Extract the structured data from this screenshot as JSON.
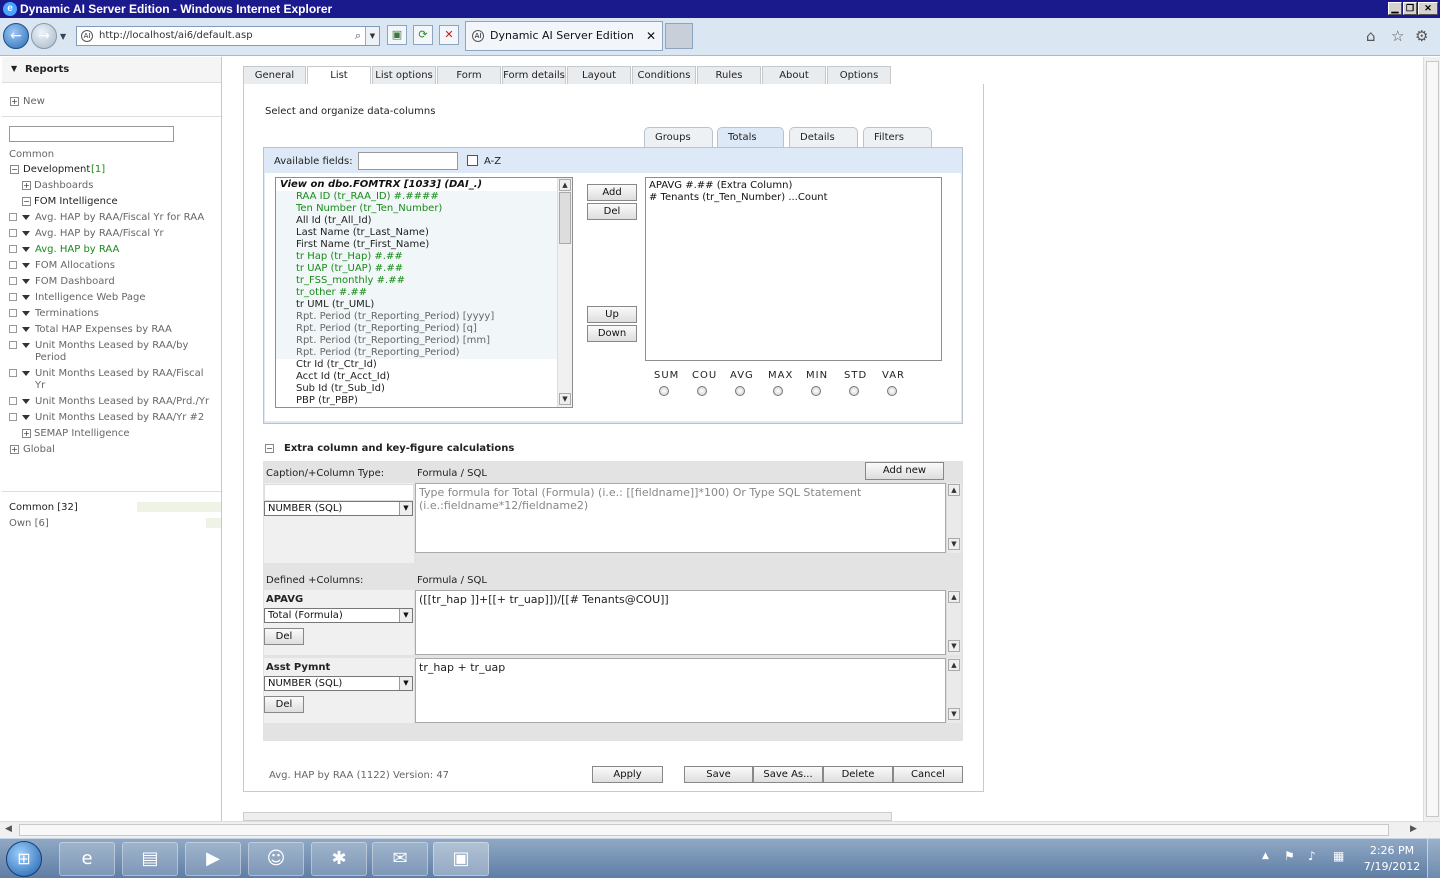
{
  "window": {
    "title": "Dynamic AI Server Edition - Windows Internet Explorer"
  },
  "browser": {
    "url": "http://localhost/ai6/default.asp",
    "tab_title": "Dynamic AI Server Edition",
    "tab_close": "✕"
  },
  "sidebar": {
    "header": "Reports",
    "new": "New",
    "common_label": "Common",
    "development": "Development",
    "development_count": "[1]",
    "dashboards": "Dashboards",
    "fom_intelligence": "FOM Intelligence",
    "reports": [
      "Avg. HAP by RAA/Fiscal Yr for RAA",
      "Avg. HAP by RAA/Fiscal Yr",
      "Avg. HAP by RAA",
      "FOM Allocations",
      "FOM Dashboard",
      "Intelligence Web Page",
      "Terminations",
      "Total HAP Expenses by RAA",
      "Unit Months Leased by RAA/by",
      "Period",
      "Unit Months Leased by RAA/Fiscal",
      "Yr",
      "Unit Months Leased by RAA/Prd./Yr",
      "Unit Months Leased by RAA/Yr #2"
    ],
    "semap": "SEMAP Intelligence",
    "global": "Global",
    "common_count": "Common [32]",
    "own_count": "Own [6]"
  },
  "tabs": [
    "General",
    "List",
    "List options",
    "Form",
    "Form details",
    "Layout",
    "Conditions",
    "Rules",
    "About",
    "Options"
  ],
  "main": {
    "instruction": "Select and organize data-columns",
    "subtabs": [
      "Groups",
      "Totals",
      "Details",
      "Filters"
    ],
    "available_fields_label": "Available fields:",
    "az_label": "A-Z",
    "field_list_header": "View on dbo.FOMTRX [1033] (DAI_.)",
    "fields": [
      "RAA ID (tr_RAA_ID) #.####",
      "Ten Number (tr_Ten_Number)",
      "All Id (tr_All_Id)",
      "Last Name (tr_Last_Name)",
      "First Name (tr_First_Name)",
      "tr Hap (tr_Hap) #.##",
      "tr UAP (tr_UAP) #.##",
      "tr_FSS_monthly #.##",
      "tr_other #.##",
      "tr UML (tr_UML)",
      "Rpt. Period (tr_Reporting_Period) [yyyy]",
      "Rpt. Period (tr_Reporting_Period) [q]",
      "Rpt. Period (tr_Reporting_Period) [mm]",
      "Rpt. Period (tr_Reporting_Period)",
      "Ctr Id (tr_Ctr_Id)",
      "Acct Id (tr_Acct_Id)",
      "Sub Id (tr_Sub_Id)",
      "PBP (tr_PBP)"
    ],
    "btn_add": "Add",
    "btn_del": "Del",
    "btn_up": "Up",
    "btn_down": "Down",
    "selected": [
      "APAVG #.## (Extra Column)",
      "# Tenants (tr_Ten_Number) ...Count"
    ],
    "aggregates": [
      "SUM",
      "COU",
      "AVG",
      "MAX",
      "MIN",
      "STD",
      "VAR"
    ],
    "extra_section_title": "Extra column and key-figure calculations",
    "caption_col_label": "Caption/+Column Type:",
    "formula_label": "Formula / SQL",
    "add_new": "Add new",
    "new_type": "NUMBER (SQL)",
    "formula_placeholder": "Type formula for Total (Formula) (i.e.: [[fieldname]]*100) Or Type SQL Statement (i.e.:fieldname*12/fieldname2)",
    "defined_label": "Defined +Columns:",
    "defined": [
      {
        "name": "APAVG",
        "type": "Total (Formula)",
        "formula": "([[tr_hap ]]+[[+ tr_uap]])/[[# Tenants@COU]]",
        "del": "Del"
      },
      {
        "name": "Asst Pymnt",
        "type": "NUMBER (SQL)",
        "formula": "tr_hap + tr_uap",
        "del": "Del"
      }
    ],
    "footer_info": "Avg. HAP by RAA (1122) Version: 47",
    "btn_apply": "Apply",
    "btn_save": "Save",
    "btn_saveas": "Save As...",
    "btn_delete": "Delete",
    "btn_cancel": "Cancel"
  },
  "clock": {
    "time": "2:26 PM",
    "date": "7/19/2012"
  },
  "colors": {
    "titlebar": "#1a1a8c",
    "green_text": "#1a8a1a",
    "panel_blue": "#dde9f6"
  }
}
